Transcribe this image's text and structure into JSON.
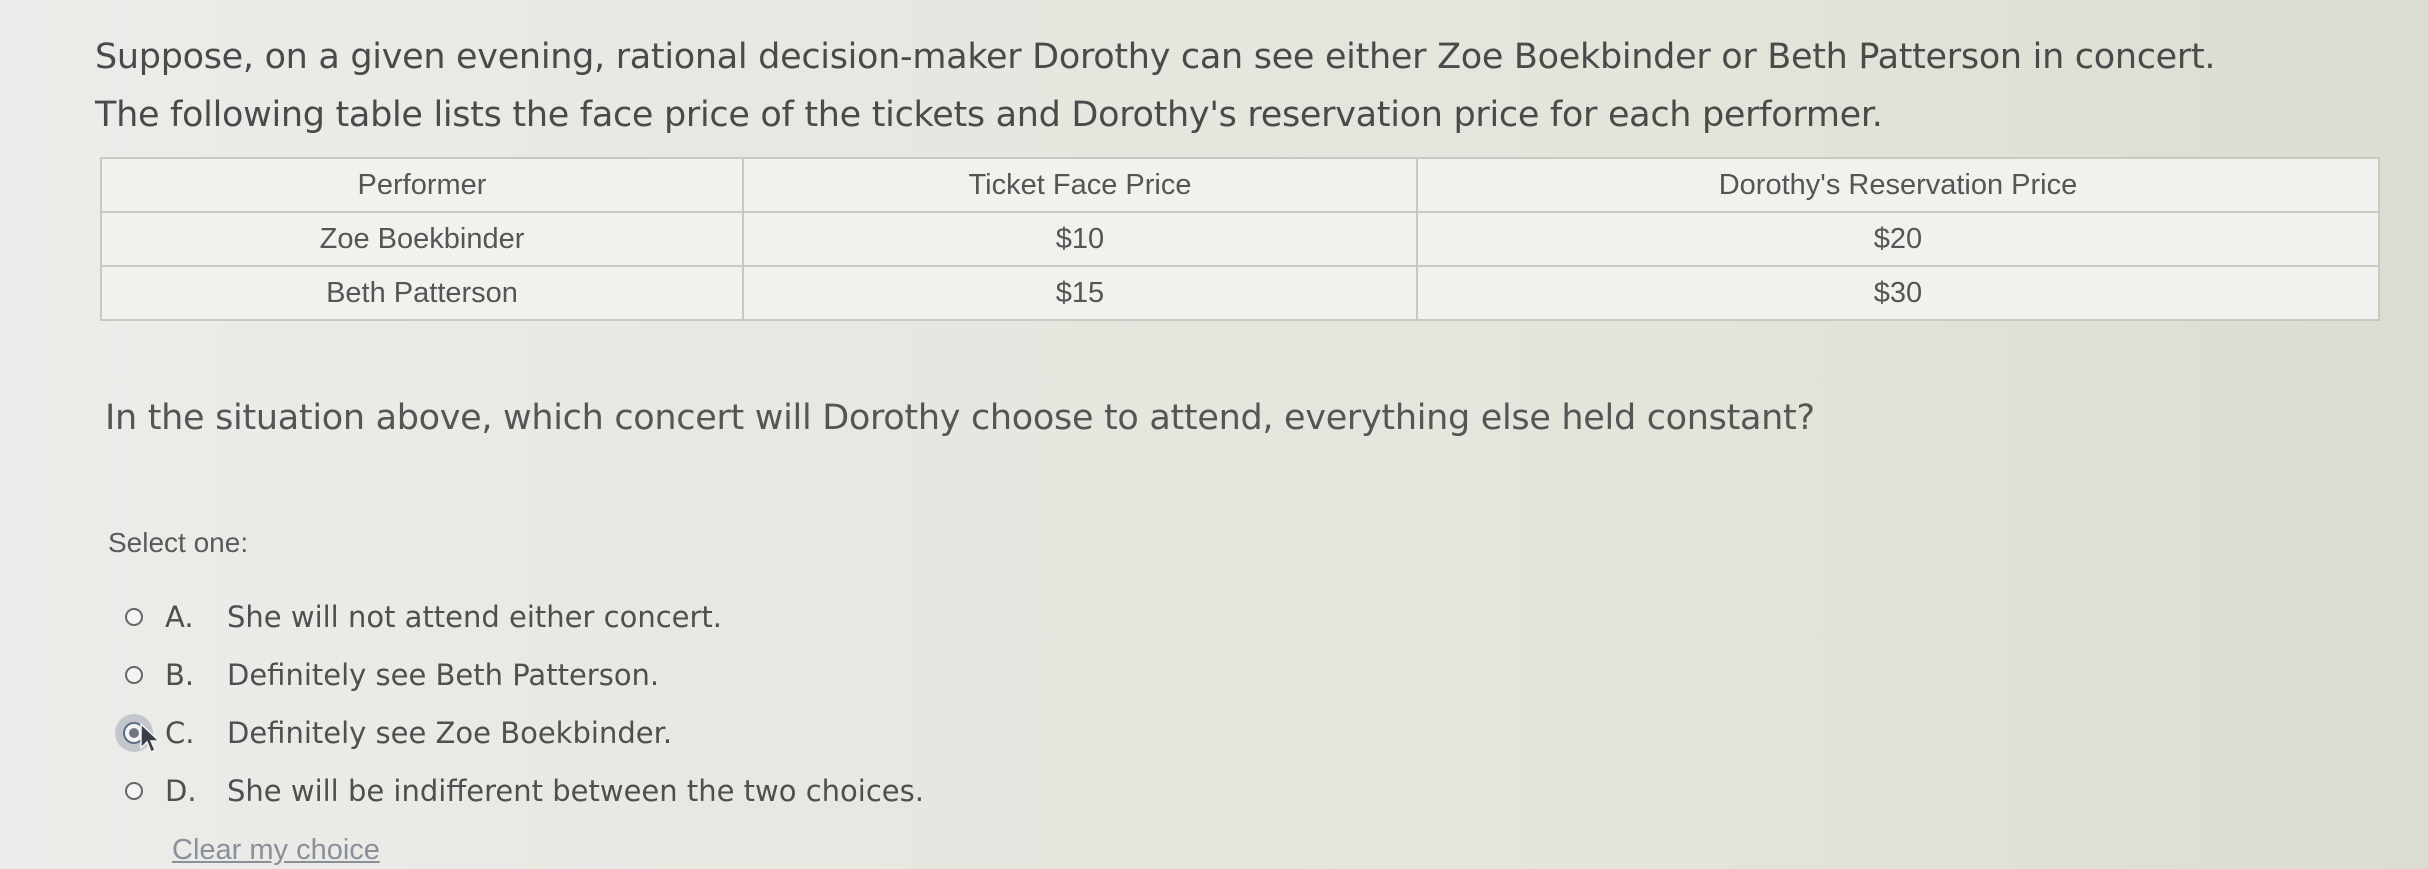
{
  "intro": {
    "line1": "Suppose, on a given evening, rational decision-maker Dorothy can see either Zoe Boekbinder or Beth Patterson in concert.",
    "line2": "The following table lists the face price of the tickets and Dorothy's reservation price for each performer."
  },
  "table": {
    "headers": [
      "Performer",
      "Ticket Face Price",
      "Dorothy's Reservation Price"
    ],
    "rows": [
      [
        "Zoe Boekbinder",
        "$10",
        "$20"
      ],
      [
        "Beth Patterson",
        "$15",
        "$30"
      ]
    ]
  },
  "question": "In the situation above, which concert will Dorothy choose to attend, everything else held constant?",
  "prompt": "Select one:",
  "options": [
    {
      "letter": "A.",
      "text": "She will not attend either concert.",
      "selected": false
    },
    {
      "letter": "B.",
      "text": "Definitely see Beth Patterson.",
      "selected": false
    },
    {
      "letter": "C.",
      "text": "Definitely see Zoe Boekbinder.",
      "selected": true
    },
    {
      "letter": "D.",
      "text": "She will be indifferent between the two choices.",
      "selected": false
    }
  ],
  "clear_label": "Clear my choice",
  "colors": {
    "background": "#e6e7e0",
    "text": "#4a4a4a",
    "link": "#8a8f9a"
  }
}
